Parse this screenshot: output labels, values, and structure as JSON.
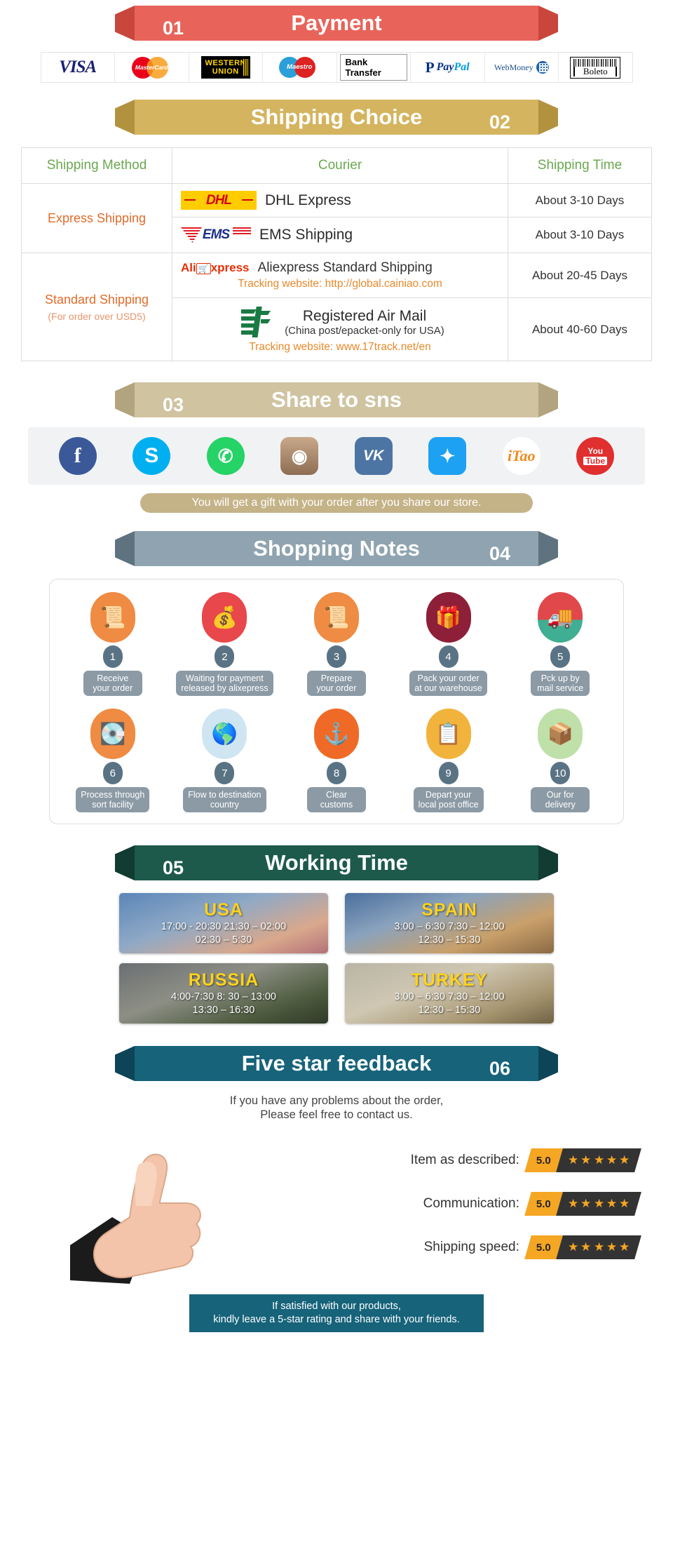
{
  "sections": {
    "payment": {
      "number": "01",
      "title": "Payment",
      "color": "#e8645a",
      "methods": [
        {
          "name": "visa",
          "label": "VISA"
        },
        {
          "name": "mastercard",
          "label": "MasterCard"
        },
        {
          "name": "western-union",
          "label_line1": "WESTERN",
          "label_line2": "UNION"
        },
        {
          "name": "maestro",
          "label": "Maestro"
        },
        {
          "name": "bank-transfer",
          "label": "Bank Transfer"
        },
        {
          "name": "paypal",
          "label_a": "Pay",
          "label_b": "Pal",
          "glyph": "P"
        },
        {
          "name": "webmoney",
          "label": "WebMoney"
        },
        {
          "name": "boleto",
          "label": "Boleto"
        }
      ]
    },
    "shipping": {
      "number": "02",
      "title": "Shipping Choice",
      "color": "#d4b45e",
      "headers": [
        "Shipping Method",
        "Courier",
        "Shipping Time"
      ],
      "rows": [
        {
          "method": "Express Shipping",
          "method_note": "",
          "couriers": [
            {
              "logo": "dhl-logo",
              "logo_text": "DHL",
              "name": "DHL Express",
              "sub": "",
              "tracking": "",
              "time": "About 3-10 Days"
            },
            {
              "logo": "ems-logo",
              "logo_text": "EMS",
              "name": "EMS Shipping",
              "sub": "",
              "tracking": "",
              "time": "About 3-10 Days"
            }
          ]
        },
        {
          "method": "Standard Shipping",
          "method_note": "(For order over USD5)",
          "couriers": [
            {
              "logo": "aliexpress-logo",
              "logo_text": "Ali xpress",
              "name": "Aliexpress Standard Shipping",
              "sub": "",
              "tracking": "Tracking website: http://global.cainiao.com",
              "time": "About 20-45 Days"
            },
            {
              "logo": "china-post-logo",
              "logo_text": "",
              "name": "Registered Air Mail",
              "sub": "(China post/epacket-only for USA)",
              "tracking": "Tracking website: www.17track.net/en",
              "time": "About 40-60 Days"
            }
          ]
        }
      ]
    },
    "share": {
      "number": "03",
      "title": "Share to sns",
      "color": "#cfc3a0",
      "networks": [
        {
          "name": "facebook-icon",
          "glyph": "f",
          "bg": "#3b5998",
          "shape": "circle"
        },
        {
          "name": "skype-icon",
          "glyph": "S",
          "bg": "#00aff0",
          "shape": "circle"
        },
        {
          "name": "whatsapp-icon",
          "glyph": "✆",
          "bg": "#25d366",
          "shape": "circle"
        },
        {
          "name": "instagram-icon",
          "glyph": "◉",
          "bg": "#8d6e53",
          "shape": "rounded"
        },
        {
          "name": "vk-icon",
          "glyph": "VK",
          "bg": "#4c75a3",
          "shape": "rounded"
        },
        {
          "name": "twitter-icon",
          "glyph": "✦",
          "bg": "#1da1f2",
          "shape": "rounded"
        },
        {
          "name": "itao-icon",
          "glyph": "iTao",
          "bg": "#ffffff",
          "shape": "circle"
        },
        {
          "name": "youtube-icon",
          "glyph": "You",
          "glyph2": "Tube",
          "bg": "#e02f2f",
          "shape": "circle"
        }
      ],
      "gift_note": "You will get a gift with your order after you share our store."
    },
    "notes": {
      "number": "04",
      "title": "Shopping Notes",
      "color": "#8fa3b0",
      "steps": [
        {
          "num": "1",
          "label": "Receive\nyour order",
          "icon": "document-icon",
          "bg": "#ef8b42"
        },
        {
          "num": "2",
          "label": "Waiting for payment\nreleased by alixepress",
          "icon": "money-bag-icon",
          "bg": "#e8474b"
        },
        {
          "num": "3",
          "label": "Prepare\nyour order",
          "icon": "document-icon",
          "bg": "#ef8b42"
        },
        {
          "num": "4",
          "label": "Pack your order\nat our warehouse",
          "icon": "gift-box-icon",
          "bg": "#8d1f38"
        },
        {
          "num": "5",
          "label": "Pck up by\nmail service",
          "icon": "mail-truck-icon",
          "bg": "#e0484c"
        },
        {
          "num": "6",
          "label": "Process through\nsort facility",
          "icon": "scanner-icon",
          "bg": "#ef8b42"
        },
        {
          "num": "7",
          "label": "Flow to destination\ncountry",
          "icon": "globe-icon",
          "bg": "#cfe5f2"
        },
        {
          "num": "8",
          "label": "Clear\ncustoms",
          "icon": "anchor-icon",
          "bg": "#ef6a26"
        },
        {
          "num": "9",
          "label": "Depart your\nlocal post office",
          "icon": "clipboard-icon",
          "bg": "#f2b33d"
        },
        {
          "num": "10",
          "label": "Our for\ndelivery",
          "icon": "package-icon",
          "bg": "#bfe0a8"
        }
      ]
    },
    "working_time": {
      "number": "05",
      "title": "Working Time",
      "color": "#1d5a4c",
      "cities": [
        {
          "name": "USA",
          "class": "tc-usa",
          "lines": [
            "17:00 - 20:30  21:30 – 02:00",
            "02:30 – 5:30"
          ]
        },
        {
          "name": "SPAIN",
          "class": "tc-spain",
          "lines": [
            "3:00 – 6:30   7:30 – 12:00",
            "12:30 – 15:30"
          ]
        },
        {
          "name": "RUSSIA",
          "class": "tc-russia",
          "lines": [
            "4:00-7:30  8: 30 – 13:00",
            "13:30 – 16:30"
          ]
        },
        {
          "name": "TURKEY",
          "class": "tc-turkey",
          "lines": [
            "3:00 – 6:30  7:30 – 12:00",
            "12:30 – 15:30"
          ]
        }
      ]
    },
    "feedback": {
      "number": "06",
      "title": "Five star feedback",
      "color": "#16637a",
      "intro_line1": "If you have any problems about the order,",
      "intro_line2": "Please feel free to contact us.",
      "ratings": [
        {
          "label": "Item as described:",
          "score": "5.0",
          "stars": 5
        },
        {
          "label": "Communication:",
          "score": "5.0",
          "stars": 5
        },
        {
          "label": "Shipping speed:",
          "score": "5.0",
          "stars": 5
        }
      ],
      "closing_line1": "If satisfied with our products,",
      "closing_line2": "kindly leave a 5-star rating and share with your friends."
    }
  }
}
